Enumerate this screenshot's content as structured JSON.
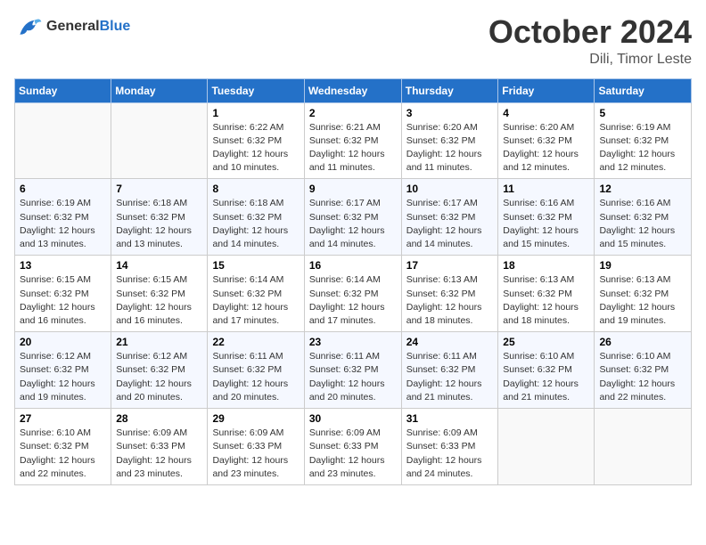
{
  "header": {
    "logo_line1": "General",
    "logo_line2": "Blue",
    "month": "October 2024",
    "location": "Dili, Timor Leste"
  },
  "days_of_week": [
    "Sunday",
    "Monday",
    "Tuesday",
    "Wednesday",
    "Thursday",
    "Friday",
    "Saturday"
  ],
  "weeks": [
    [
      {
        "num": "",
        "info": ""
      },
      {
        "num": "",
        "info": ""
      },
      {
        "num": "1",
        "info": "Sunrise: 6:22 AM\nSunset: 6:32 PM\nDaylight: 12 hours\nand 10 minutes."
      },
      {
        "num": "2",
        "info": "Sunrise: 6:21 AM\nSunset: 6:32 PM\nDaylight: 12 hours\nand 11 minutes."
      },
      {
        "num": "3",
        "info": "Sunrise: 6:20 AM\nSunset: 6:32 PM\nDaylight: 12 hours\nand 11 minutes."
      },
      {
        "num": "4",
        "info": "Sunrise: 6:20 AM\nSunset: 6:32 PM\nDaylight: 12 hours\nand 12 minutes."
      },
      {
        "num": "5",
        "info": "Sunrise: 6:19 AM\nSunset: 6:32 PM\nDaylight: 12 hours\nand 12 minutes."
      }
    ],
    [
      {
        "num": "6",
        "info": "Sunrise: 6:19 AM\nSunset: 6:32 PM\nDaylight: 12 hours\nand 13 minutes."
      },
      {
        "num": "7",
        "info": "Sunrise: 6:18 AM\nSunset: 6:32 PM\nDaylight: 12 hours\nand 13 minutes."
      },
      {
        "num": "8",
        "info": "Sunrise: 6:18 AM\nSunset: 6:32 PM\nDaylight: 12 hours\nand 14 minutes."
      },
      {
        "num": "9",
        "info": "Sunrise: 6:17 AM\nSunset: 6:32 PM\nDaylight: 12 hours\nand 14 minutes."
      },
      {
        "num": "10",
        "info": "Sunrise: 6:17 AM\nSunset: 6:32 PM\nDaylight: 12 hours\nand 14 minutes."
      },
      {
        "num": "11",
        "info": "Sunrise: 6:16 AM\nSunset: 6:32 PM\nDaylight: 12 hours\nand 15 minutes."
      },
      {
        "num": "12",
        "info": "Sunrise: 6:16 AM\nSunset: 6:32 PM\nDaylight: 12 hours\nand 15 minutes."
      }
    ],
    [
      {
        "num": "13",
        "info": "Sunrise: 6:15 AM\nSunset: 6:32 PM\nDaylight: 12 hours\nand 16 minutes."
      },
      {
        "num": "14",
        "info": "Sunrise: 6:15 AM\nSunset: 6:32 PM\nDaylight: 12 hours\nand 16 minutes."
      },
      {
        "num": "15",
        "info": "Sunrise: 6:14 AM\nSunset: 6:32 PM\nDaylight: 12 hours\nand 17 minutes."
      },
      {
        "num": "16",
        "info": "Sunrise: 6:14 AM\nSunset: 6:32 PM\nDaylight: 12 hours\nand 17 minutes."
      },
      {
        "num": "17",
        "info": "Sunrise: 6:13 AM\nSunset: 6:32 PM\nDaylight: 12 hours\nand 18 minutes."
      },
      {
        "num": "18",
        "info": "Sunrise: 6:13 AM\nSunset: 6:32 PM\nDaylight: 12 hours\nand 18 minutes."
      },
      {
        "num": "19",
        "info": "Sunrise: 6:13 AM\nSunset: 6:32 PM\nDaylight: 12 hours\nand 19 minutes."
      }
    ],
    [
      {
        "num": "20",
        "info": "Sunrise: 6:12 AM\nSunset: 6:32 PM\nDaylight: 12 hours\nand 19 minutes."
      },
      {
        "num": "21",
        "info": "Sunrise: 6:12 AM\nSunset: 6:32 PM\nDaylight: 12 hours\nand 20 minutes."
      },
      {
        "num": "22",
        "info": "Sunrise: 6:11 AM\nSunset: 6:32 PM\nDaylight: 12 hours\nand 20 minutes."
      },
      {
        "num": "23",
        "info": "Sunrise: 6:11 AM\nSunset: 6:32 PM\nDaylight: 12 hours\nand 20 minutes."
      },
      {
        "num": "24",
        "info": "Sunrise: 6:11 AM\nSunset: 6:32 PM\nDaylight: 12 hours\nand 21 minutes."
      },
      {
        "num": "25",
        "info": "Sunrise: 6:10 AM\nSunset: 6:32 PM\nDaylight: 12 hours\nand 21 minutes."
      },
      {
        "num": "26",
        "info": "Sunrise: 6:10 AM\nSunset: 6:32 PM\nDaylight: 12 hours\nand 22 minutes."
      }
    ],
    [
      {
        "num": "27",
        "info": "Sunrise: 6:10 AM\nSunset: 6:32 PM\nDaylight: 12 hours\nand 22 minutes."
      },
      {
        "num": "28",
        "info": "Sunrise: 6:09 AM\nSunset: 6:33 PM\nDaylight: 12 hours\nand 23 minutes."
      },
      {
        "num": "29",
        "info": "Sunrise: 6:09 AM\nSunset: 6:33 PM\nDaylight: 12 hours\nand 23 minutes."
      },
      {
        "num": "30",
        "info": "Sunrise: 6:09 AM\nSunset: 6:33 PM\nDaylight: 12 hours\nand 23 minutes."
      },
      {
        "num": "31",
        "info": "Sunrise: 6:09 AM\nSunset: 6:33 PM\nDaylight: 12 hours\nand 24 minutes."
      },
      {
        "num": "",
        "info": ""
      },
      {
        "num": "",
        "info": ""
      }
    ]
  ]
}
